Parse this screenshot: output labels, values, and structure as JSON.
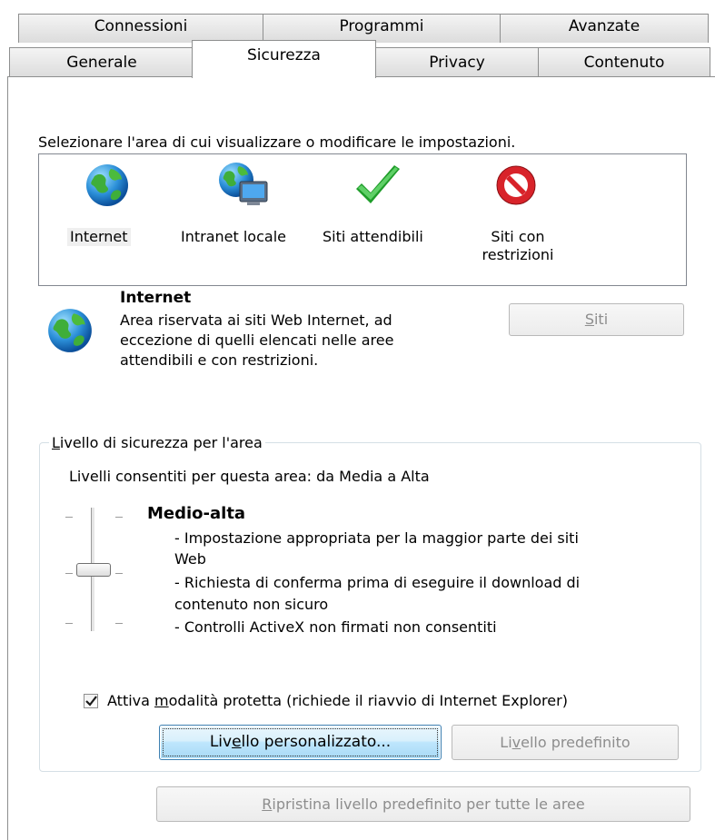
{
  "tabs": {
    "row1": [
      "Connessioni",
      "Programmi",
      "Avanzate"
    ],
    "row2": [
      "Generale",
      "Sicurezza",
      "Privacy",
      "Contenuto"
    ],
    "active": "Sicurezza"
  },
  "zones": {
    "prompt": "Selezionare l'area di cui visualizzare o modificare le impostazioni.",
    "items": [
      {
        "label": "Internet",
        "icon": "globe-icon",
        "selected": true
      },
      {
        "label": "Intranet locale",
        "icon": "intranet-icon"
      },
      {
        "label": "Siti attendibili",
        "icon": "checkmark-icon"
      },
      {
        "label_line1": "Siti con",
        "label_line2": "restrizioni",
        "icon": "restricted-icon"
      }
    ]
  },
  "zone_info": {
    "title": "Internet",
    "desc_lines": [
      "Area riservata ai siti Web Internet, ad",
      "eccezione di quelli elencati nelle aree",
      "attendibili e con restrizioni."
    ],
    "sites_button": {
      "mnemonic": "S",
      "rest": "iti"
    }
  },
  "security_level": {
    "group_title_mnemonic": "L",
    "group_title_rest": "ivello di sicurezza per l'area",
    "allowed": "Livelli consentiti per questa area: da Media a Alta",
    "level_name": "Medio-alta",
    "desc_lines": [
      "- Impostazione appropriata per la maggior parte dei siti",
      "Web",
      "- Richiesta di conferma prima di eseguire il download di",
      "contenuto non sicuro",
      "- Controlli ActiveX non firmati non consentiti"
    ],
    "protected_mode": {
      "checked": true,
      "pre": "Attiva ",
      "mnemonic": "m",
      "post": "odalità protetta (richiede il riavvio di Internet Explorer)"
    },
    "custom_button": {
      "pre": "Liv",
      "mnemonic": "e",
      "post": "llo personalizzato..."
    },
    "default_button": {
      "pre": "Li",
      "mnemonic": "v",
      "post": "ello predefinito"
    }
  },
  "reset_all": {
    "mnemonic": "R",
    "rest": "ipristina livello predefinito per tutte le aree"
  },
  "colors": {
    "tab_border": "#8e8f8f",
    "focus_button": "#3c7fb1",
    "checkmark": "#1f9d2a",
    "restricted": "#d8232a",
    "globe": "#2b8fd8"
  }
}
